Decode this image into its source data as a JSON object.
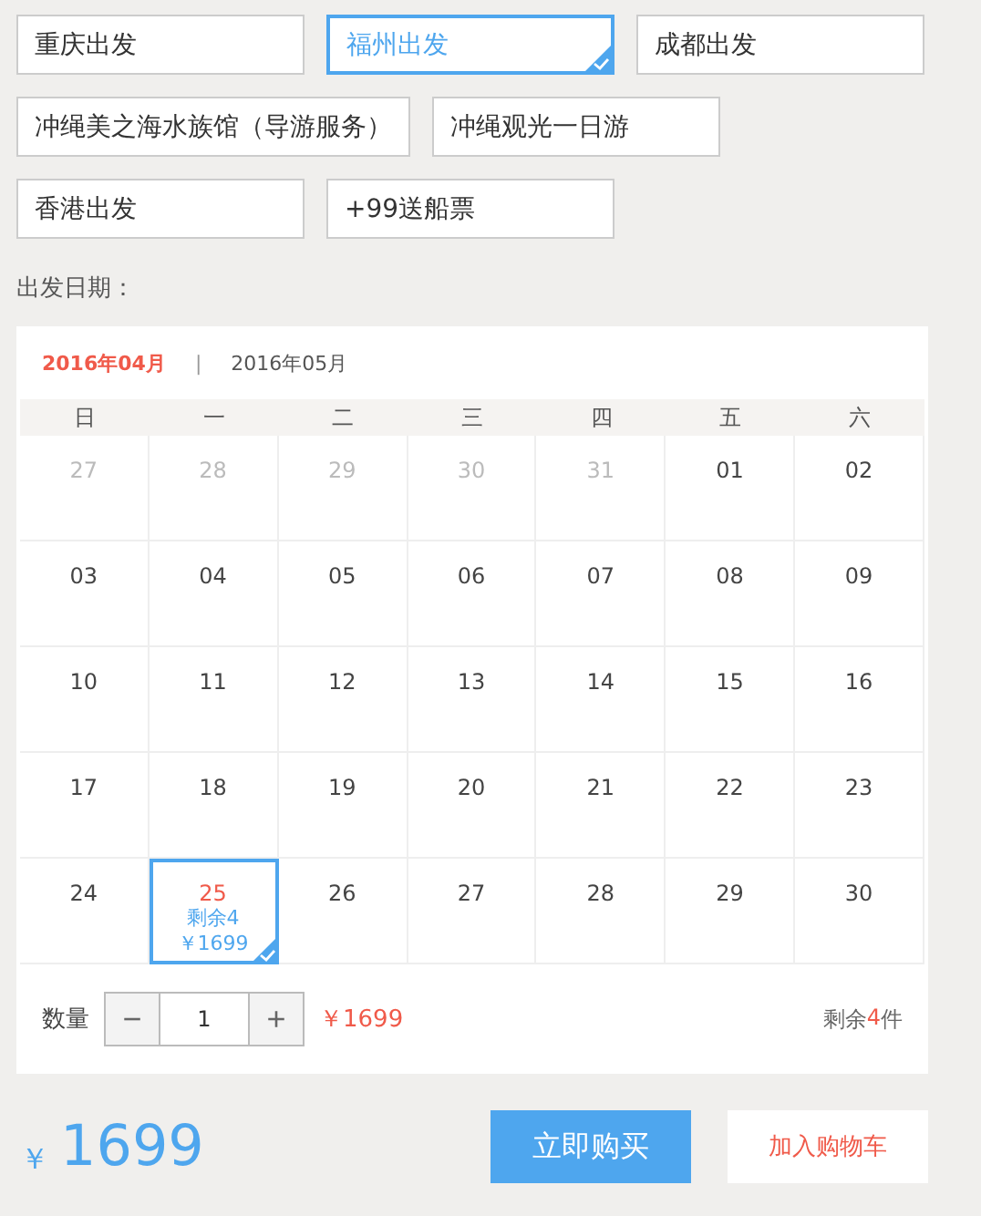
{
  "options": [
    [
      {
        "label": "重庆出发",
        "selected": false
      },
      {
        "label": "福州出发",
        "selected": true
      },
      {
        "label": "成都出发",
        "selected": false
      }
    ],
    [
      {
        "label": "冲绳美之海水族馆（导游服务）",
        "selected": false
      },
      {
        "label": "冲绳观光一日游",
        "selected": false
      }
    ],
    [
      {
        "label": "香港出发",
        "selected": false
      },
      {
        "label": "+99送船票",
        "selected": false
      }
    ]
  ],
  "date_label": "出发日期：",
  "months": [
    {
      "label": "2016年04月",
      "selected": true
    },
    {
      "label": "2016年05月",
      "selected": false
    }
  ],
  "month_separator": "|",
  "weekdays": [
    "日",
    "一",
    "二",
    "三",
    "四",
    "五",
    "六"
  ],
  "weeks": [
    [
      {
        "day": "27",
        "muted": true,
        "selected": false
      },
      {
        "day": "28",
        "muted": true,
        "selected": false
      },
      {
        "day": "29",
        "muted": true,
        "selected": false
      },
      {
        "day": "30",
        "muted": true,
        "selected": false
      },
      {
        "day": "31",
        "muted": true,
        "selected": false
      },
      {
        "day": "01",
        "muted": false,
        "selected": false
      },
      {
        "day": "02",
        "muted": false,
        "selected": false
      }
    ],
    [
      {
        "day": "03",
        "muted": false,
        "selected": false
      },
      {
        "day": "04",
        "muted": false,
        "selected": false
      },
      {
        "day": "05",
        "muted": false,
        "selected": false
      },
      {
        "day": "06",
        "muted": false,
        "selected": false
      },
      {
        "day": "07",
        "muted": false,
        "selected": false
      },
      {
        "day": "08",
        "muted": false,
        "selected": false
      },
      {
        "day": "09",
        "muted": false,
        "selected": false
      }
    ],
    [
      {
        "day": "10",
        "muted": false,
        "selected": false
      },
      {
        "day": "11",
        "muted": false,
        "selected": false
      },
      {
        "day": "12",
        "muted": false,
        "selected": false
      },
      {
        "day": "13",
        "muted": false,
        "selected": false
      },
      {
        "day": "14",
        "muted": false,
        "selected": false
      },
      {
        "day": "15",
        "muted": false,
        "selected": false
      },
      {
        "day": "16",
        "muted": false,
        "selected": false
      }
    ],
    [
      {
        "day": "17",
        "muted": false,
        "selected": false
      },
      {
        "day": "18",
        "muted": false,
        "selected": false
      },
      {
        "day": "19",
        "muted": false,
        "selected": false
      },
      {
        "day": "20",
        "muted": false,
        "selected": false
      },
      {
        "day": "21",
        "muted": false,
        "selected": false
      },
      {
        "day": "22",
        "muted": false,
        "selected": false
      },
      {
        "day": "23",
        "muted": false,
        "selected": false
      }
    ],
    [
      {
        "day": "24",
        "muted": false,
        "selected": false
      },
      {
        "day": "25",
        "muted": false,
        "selected": true,
        "stock": "剩余4",
        "price": "￥1699"
      },
      {
        "day": "26",
        "muted": false,
        "selected": false
      },
      {
        "day": "27",
        "muted": false,
        "selected": false
      },
      {
        "day": "28",
        "muted": false,
        "selected": false
      },
      {
        "day": "29",
        "muted": false,
        "selected": false
      },
      {
        "day": "30",
        "muted": false,
        "selected": false
      }
    ]
  ],
  "quantity": {
    "label": "数量",
    "minus": "−",
    "value": "1",
    "plus": "+",
    "subtotal": "￥1699",
    "remaining_prefix": "剩余",
    "remaining_count": "4",
    "remaining_suffix": "件"
  },
  "total": {
    "currency": "￥",
    "amount": "1699"
  },
  "buttons": {
    "buy": "立即购买",
    "cart": "加入购物车"
  }
}
